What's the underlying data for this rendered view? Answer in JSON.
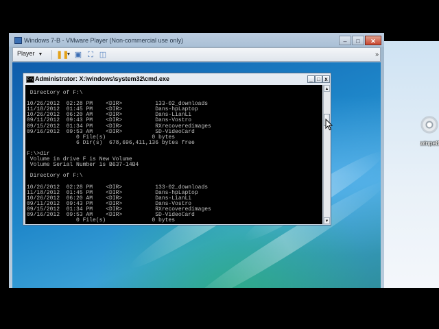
{
  "host": {
    "desktop_icon_label": "winpe8",
    "player_title": "Windows 7-B - VMware Player (Non-commercial use only)",
    "menu_label": "Player",
    "caption_buttons": {
      "minimize": "–",
      "maximize": "□",
      "close": "✕"
    }
  },
  "cmd": {
    "title": "Administrator: X:\\windows\\system32\\cmd.exe",
    "icon_text": "C:\\",
    "buttons": {
      "minimize": "_",
      "maximize": "□",
      "close": "x"
    },
    "lines": [
      " Directory of F:\\",
      "",
      "10/26/2012  02:28 PM    <DIR>          133-02_downloads",
      "11/18/2012  01:45 PM    <DIR>          Dans-hpLaptop",
      "10/26/2012  06:20 AM    <DIR>          Dans-LianLi",
      "09/11/2012  09:43 PM    <DIR>          Dans-Vostro",
      "09/15/2012  01:34 PM    <DIR>          RXrecoveredimages",
      "09/16/2012  09:53 AM    <DIR>          SD-VideoCard",
      "               0 File(s)              0 bytes",
      "               6 Dir(s)  678,696,411,136 bytes free",
      "",
      "F:\\>dir",
      " Volume in drive F is New Volume",
      " Volume Serial Number is B637-14B4",
      "",
      " Directory of F:\\",
      "",
      "10/26/2012  02:28 PM    <DIR>          133-02_downloads",
      "11/18/2012  01:45 PM    <DIR>          Dans-hpLaptop",
      "10/26/2012  06:20 AM    <DIR>          Dans-LianLi",
      "09/11/2012  09:43 PM    <DIR>          Dans-Vostro",
      "09/15/2012  01:34 PM    <DIR>          RXrecoveredimages",
      "09/16/2012  09:53 AM    <DIR>          SD-VideoCard",
      "               0 File(s)              0 bytes"
    ]
  },
  "colors": {
    "console_bg": "#000000",
    "console_text": "#c0c0c0",
    "guest_desktop": "#1e86c9"
  }
}
